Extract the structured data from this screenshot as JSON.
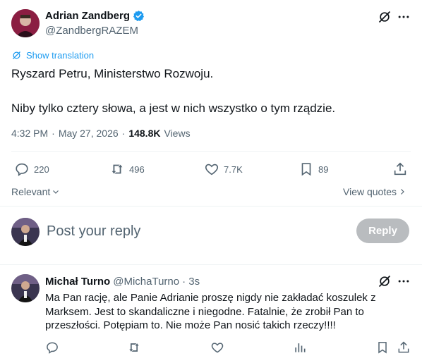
{
  "tweet": {
    "author_name": "Adrian Zandberg",
    "author_handle": "@ZandbergRAZEM",
    "show_translation": "Show translation",
    "text_line1": "Ryszard Petru, Ministerstwo Rozwoju.",
    "text_line2": "Niby tylko cztery słowa, a jest w nich wszystko o tym rządzie.",
    "time": "4:32 PM",
    "separator": "·",
    "date": "May 27, 2026",
    "views_count": "148.8K",
    "views_label": "Views",
    "replies": "220",
    "reposts": "496",
    "likes": "7.7K",
    "bookmarks": "89"
  },
  "filters": {
    "relevant_label": "Relevant",
    "view_quotes_label": "View quotes"
  },
  "composer": {
    "placeholder": "Post your reply",
    "reply_button": "Reply"
  },
  "reply": {
    "author_name": "Michał Turno",
    "author_handle": "@MichaTurno",
    "time": "· 3s",
    "text": "Ma Pan rację, ale Panie Adrianie proszę nigdy nie zakładać koszulek z Marksem. Jest to skandaliczne i niegodne. Fatalnie, że zrobił Pan to przeszłości. Potępiam to. Nie może Pan nosić takich rzeczy!!!!"
  },
  "colors": {
    "accent": "#1d9bf0",
    "muted": "#536471",
    "verified": "#1d9bf0",
    "reply_button_disabled": "#b9bcbf"
  },
  "icons": [
    "verified-icon",
    "grok-icon",
    "more-icon",
    "translate-icon",
    "reply-icon",
    "repost-icon",
    "like-icon",
    "bookmark-icon",
    "share-icon",
    "chevron-down-icon",
    "chevron-right-icon",
    "analytics-icon"
  ]
}
